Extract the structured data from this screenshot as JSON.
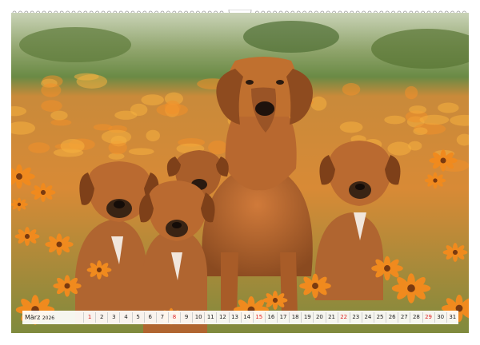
{
  "calendar": {
    "month_label": "März",
    "year": "2026",
    "days": [
      "1",
      "2",
      "3",
      "4",
      "5",
      "6",
      "7",
      "8",
      "9",
      "10",
      "11",
      "12",
      "13",
      "14",
      "15",
      "16",
      "17",
      "18",
      "19",
      "20",
      "21",
      "22",
      "23",
      "24",
      "25",
      "26",
      "27",
      "28",
      "29",
      "30",
      "31"
    ],
    "sundays": [
      "1",
      "8",
      "15",
      "22",
      "29"
    ]
  },
  "colors": {
    "sunday": "#dd2222",
    "coat": "#b8682f",
    "flower": "#f08a1e"
  }
}
